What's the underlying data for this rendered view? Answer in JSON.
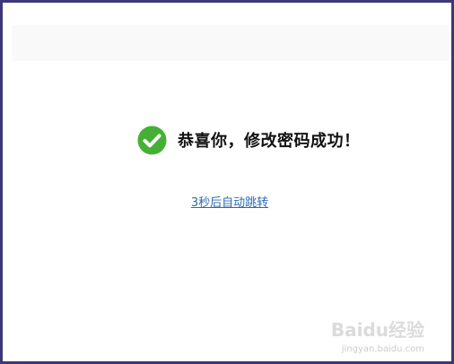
{
  "message": {
    "icon": "check-circle-icon",
    "text": "恭喜你，修改密码成功！",
    "icon_color": "#45b035"
  },
  "redirect": {
    "label": "3秒后自动跳转",
    "color": "#2a6ab0"
  },
  "watermark": {
    "logo_text": "Baidu经验",
    "sub_text": "jingyan.baidu.com"
  },
  "colors": {
    "border": "#3d3777",
    "topbar": "#f9f9f9"
  }
}
